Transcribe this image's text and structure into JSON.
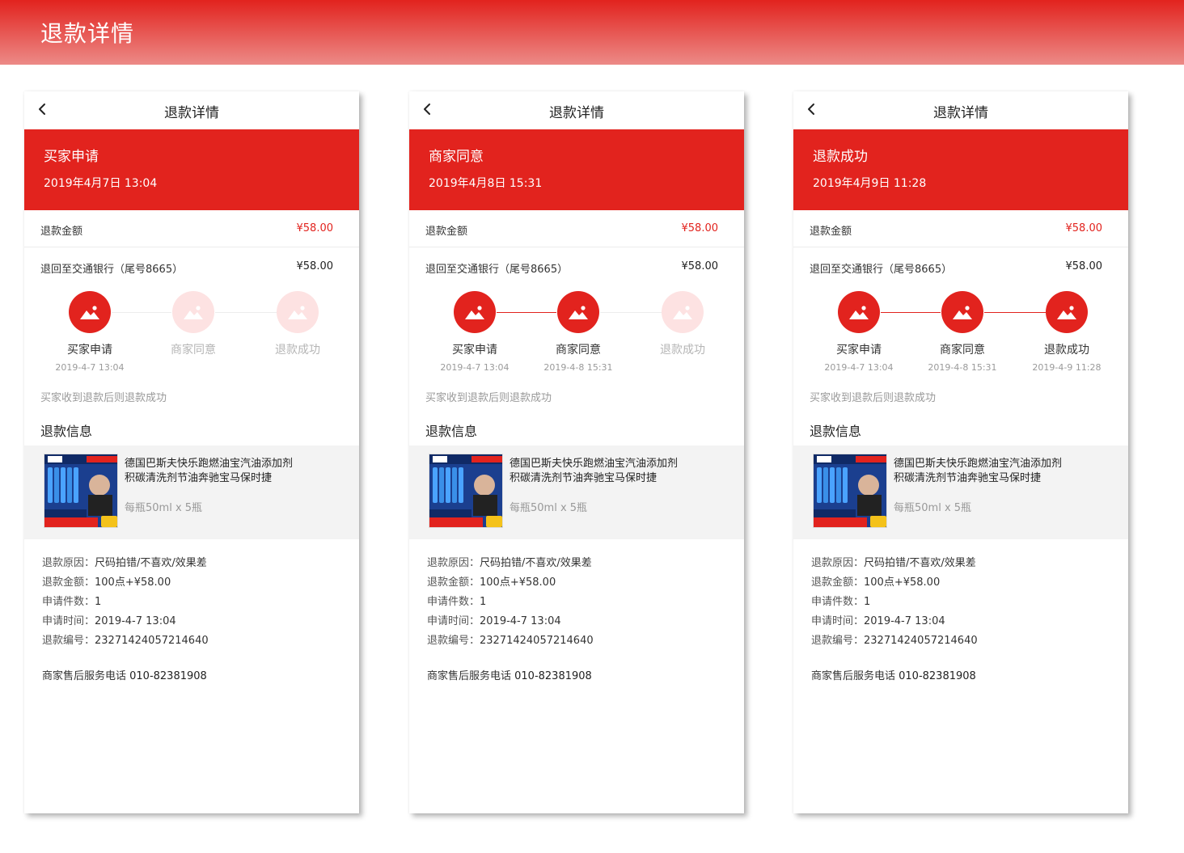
{
  "banner": {
    "title": "退款详情"
  },
  "phones": [
    {
      "nav_title": "退款详情",
      "status_title": "买家申请",
      "status_time": "2019年4月7日  13:04",
      "refund_amount_label": "退款金额",
      "refund_amount_value": "¥58.00",
      "refund_to_label": "退回至交通银行（尾号8665）",
      "refund_to_value": "¥58.00",
      "steps": [
        {
          "label": "买家申请",
          "time": "2019-4-7 13:04",
          "done": true
        },
        {
          "label": "商家同意",
          "time": "",
          "done": false
        },
        {
          "label": "退款成功",
          "time": "",
          "done": false
        }
      ],
      "note": "买家收到退款后则退款成功",
      "section_title": "退款信息",
      "product_name": "德国巴斯夫快乐跑燃油宝汽油添加剂积碳清洗剂节油奔驰宝马保时捷",
      "product_spec": "每瓶50ml x 5瓶",
      "info": [
        {
          "k": "退款原因：",
          "v": "尺码拍错/不喜欢/效果差"
        },
        {
          "k": "退款金额：",
          "v": "100点+¥58.00"
        },
        {
          "k": "申请件数：",
          "v": "1"
        },
        {
          "k": "申请时间：",
          "v": "2019-4-7 13:04"
        },
        {
          "k": "退款编号：",
          "v": "23271424057214640"
        }
      ],
      "hotline_label": "商家售后服务电话 ",
      "hotline_number": "010-82381908"
    },
    {
      "nav_title": "退款详情",
      "status_title": "商家同意",
      "status_time": "2019年4月8日  15:31",
      "refund_amount_label": "退款金额",
      "refund_amount_value": "¥58.00",
      "refund_to_label": "退回至交通银行（尾号8665）",
      "refund_to_value": "¥58.00",
      "steps": [
        {
          "label": "买家申请",
          "time": "2019-4-7 13:04",
          "done": true
        },
        {
          "label": "商家同意",
          "time": "2019-4-8 15:31",
          "done": true
        },
        {
          "label": "退款成功",
          "time": "",
          "done": false
        }
      ],
      "note": "买家收到退款后则退款成功",
      "section_title": "退款信息",
      "product_name": "德国巴斯夫快乐跑燃油宝汽油添加剂积碳清洗剂节油奔驰宝马保时捷",
      "product_spec": "每瓶50ml x 5瓶",
      "info": [
        {
          "k": "退款原因：",
          "v": "尺码拍错/不喜欢/效果差"
        },
        {
          "k": "退款金额：",
          "v": "100点+¥58.00"
        },
        {
          "k": "申请件数：",
          "v": "1"
        },
        {
          "k": "申请时间：",
          "v": "2019-4-7 13:04"
        },
        {
          "k": "退款编号：",
          "v": "23271424057214640"
        }
      ],
      "hotline_label": "商家售后服务电话 ",
      "hotline_number": "010-82381908"
    },
    {
      "nav_title": "退款详情",
      "status_title": "退款成功",
      "status_time": "2019年4月9日  11:28",
      "refund_amount_label": "退款金额",
      "refund_amount_value": "¥58.00",
      "refund_to_label": "退回至交通银行（尾号8665）",
      "refund_to_value": "¥58.00",
      "steps": [
        {
          "label": "买家申请",
          "time": "2019-4-7 13:04",
          "done": true
        },
        {
          "label": "商家同意",
          "time": "2019-4-8 15:31",
          "done": true
        },
        {
          "label": "退款成功",
          "time": "2019-4-9 11:28",
          "done": true
        }
      ],
      "note": "买家收到退款后则退款成功",
      "section_title": "退款信息",
      "product_name": "德国巴斯夫快乐跑燃油宝汽油添加剂积碳清洗剂节油奔驰宝马保时捷",
      "product_spec": "每瓶50ml x 5瓶",
      "info": [
        {
          "k": "退款原因：",
          "v": "尺码拍错/不喜欢/效果差"
        },
        {
          "k": "退款金额：",
          "v": "100点+¥58.00"
        },
        {
          "k": "申请件数：",
          "v": "1"
        },
        {
          "k": "申请时间：",
          "v": "2019-4-7 13:04"
        },
        {
          "k": "退款编号：",
          "v": "23271424057214640"
        }
      ],
      "hotline_label": "商家售后服务电话 ",
      "hotline_number": "010-82381908"
    }
  ],
  "colors": {
    "accent": "#e2231e",
    "pending_circle": "#fde2e2",
    "product_bg": "#f3f3f3"
  },
  "icons": {
    "back": "chevron-left-icon",
    "step": "image-placeholder-icon",
    "product": "product-thumbnail-image"
  }
}
